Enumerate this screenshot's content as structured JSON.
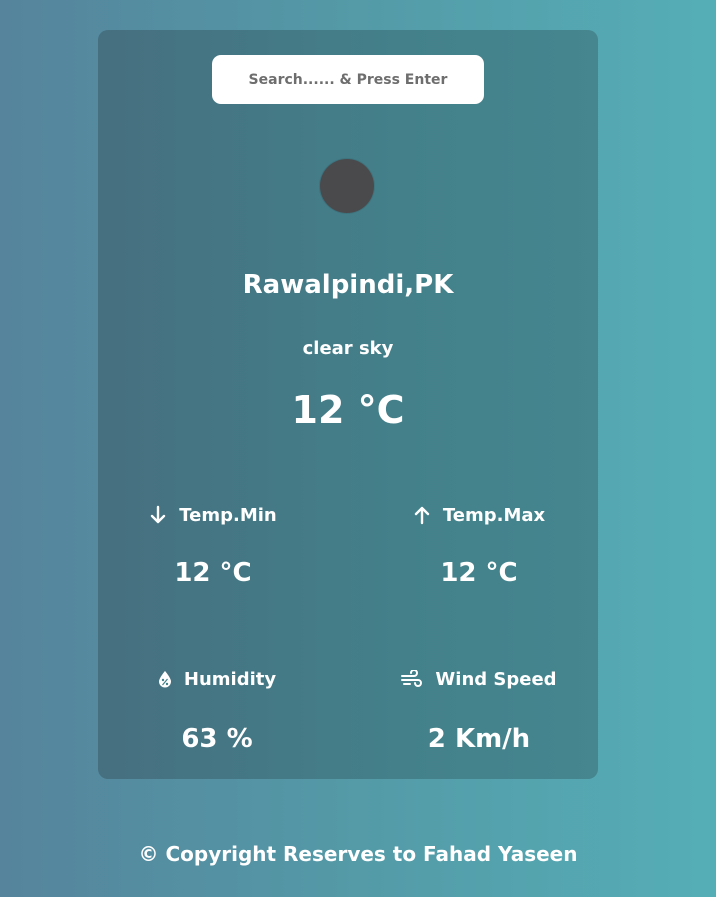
{
  "search": {
    "placeholder": "Search...... & Press Enter",
    "value": ""
  },
  "weather": {
    "icon": "weather-condition-icon",
    "city": "Rawalpindi,PK",
    "description": "clear sky",
    "temperature": "12 °C"
  },
  "stats": {
    "temp_min": {
      "icon": "arrow-down-icon",
      "label": "Temp.Min",
      "value": "12 °C"
    },
    "temp_max": {
      "icon": "arrow-up-icon",
      "label": "Temp.Max",
      "value": "12 °C"
    },
    "humidity": {
      "icon": "droplet-percent-icon",
      "label": "Humidity",
      "value": "63 %"
    },
    "wind_speed": {
      "icon": "wind-icon",
      "label": "Wind Speed",
      "value": "2 Km/h"
    }
  },
  "footer": {
    "text": "© Copyright Reserves to Fahad Yaseen"
  },
  "colors": {
    "background_left": "#55849c",
    "background_right": "#55aeb6",
    "card": "#43808a",
    "icon_placeholder": "#4a4a4d",
    "text": "#ffffff"
  }
}
